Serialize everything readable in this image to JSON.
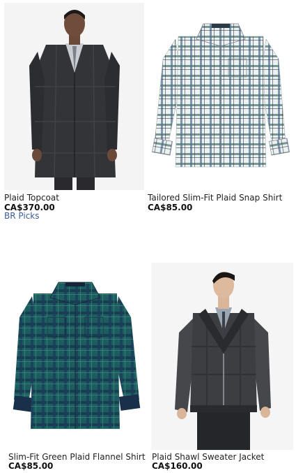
{
  "products": [
    {
      "title": "Plaid Topcoat",
      "price": "CA$370.00",
      "tag": "BR Picks",
      "image_icon": "model-topcoat-image"
    },
    {
      "title": "Tailored Slim-Fit Plaid Snap Shirt",
      "price": "CA$85.00",
      "image_icon": "plaid-shirt-image"
    },
    {
      "title": "Slim-Fit Green Plaid Flannel Shirt",
      "price": "CA$85.00",
      "image_icon": "green-flannel-shirt-image"
    },
    {
      "title": "Plaid Shawl Sweater Jacket",
      "price": "CA$160.00",
      "image_icon": "model-sweater-jacket-image"
    }
  ],
  "colors": {
    "link_blue": "#3a5b9a",
    "topcoat": "#2f3033",
    "white_plaid": "#e9ecec",
    "green_plaid": "#1e5a5a",
    "sweater": "#3c3c3e"
  }
}
